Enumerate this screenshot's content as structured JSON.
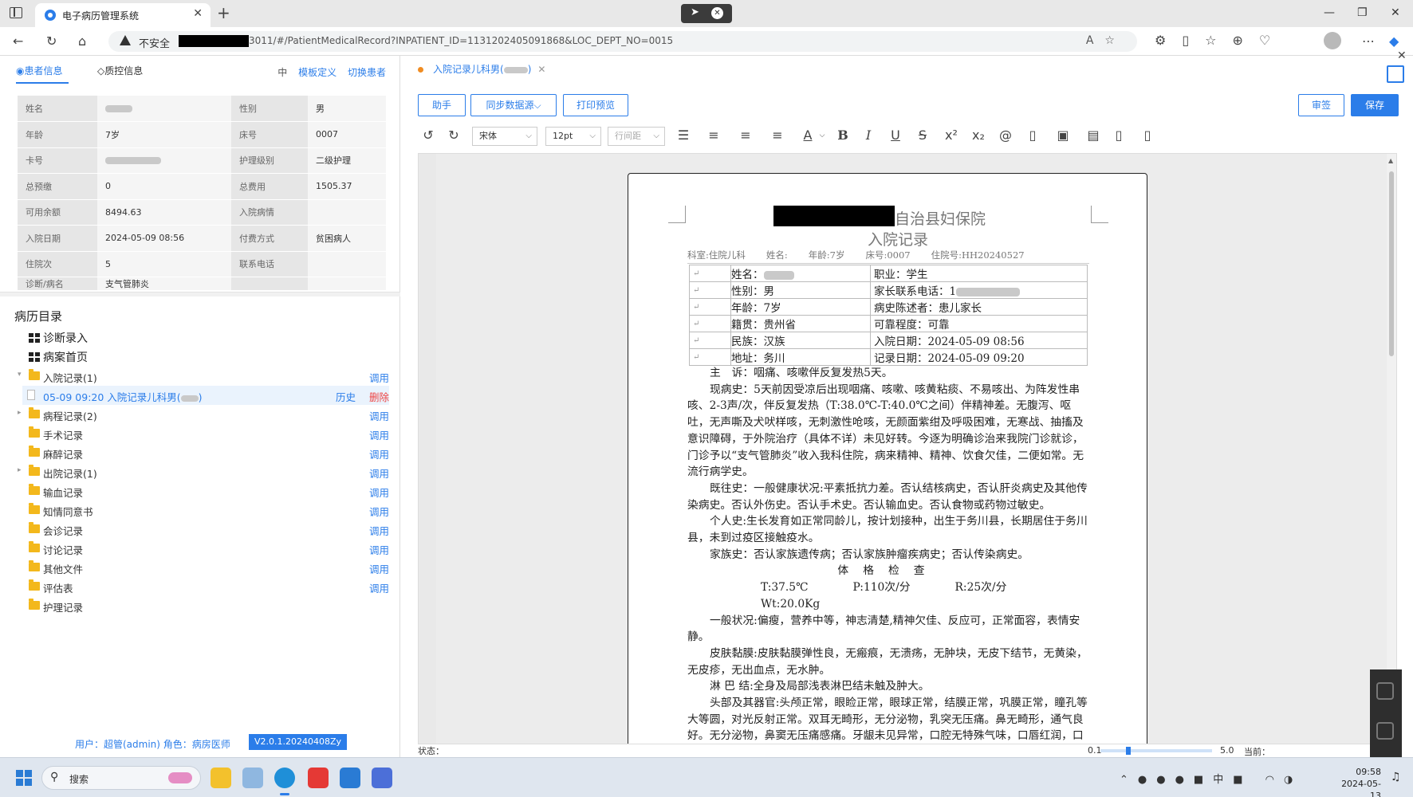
{
  "browser": {
    "tab_title": "电子病历管理系统",
    "security_label": "不安全",
    "url": "3011/#/PatientMedicalRecord?INPATIENT_ID=1131202405091868&LOC_DEPT_NO=0015"
  },
  "left": {
    "tabs": [
      "患者信息",
      "质控信息"
    ],
    "links": [
      "中",
      "模板定义",
      "切换患者"
    ],
    "info_rows": [
      {
        "k1": "姓名",
        "v1": "",
        "k2": "性别",
        "v2": "男"
      },
      {
        "k1": "年龄",
        "v1": "7岁",
        "k2": "床号",
        "v2": "0007"
      },
      {
        "k1": "卡号",
        "v1": "",
        "k2": "护理级别",
        "v2": "二级护理"
      },
      {
        "k1": "总预缴",
        "v1": "0",
        "k2": "总费用",
        "v2": "1505.37"
      },
      {
        "k1": "可用余额",
        "v1": "8494.63",
        "k2": "入院病情",
        "v2": ""
      },
      {
        "k1": "入院日期",
        "v1": "2024-05-09 08:56",
        "k2": "付费方式",
        "v2": "贫困病人"
      },
      {
        "k1": "住院次",
        "v1": "5",
        "k2": "联系电话",
        "v2": ""
      },
      {
        "k1": "诊断/病名",
        "v1": "支气管肺炎",
        "k2": "",
        "v2": ""
      }
    ],
    "tree_title": "病历目录",
    "tree": {
      "diag_entry": "诊断录入",
      "case_home": "病案首页",
      "admission": "入院记录(1)",
      "selected_record": "05-09 09:20 入院记录儿科男(",
      "history": "历史",
      "delete": "删除",
      "folders": [
        {
          "label": "病程记录(2)",
          "action": "调用"
        },
        {
          "label": "手术记录",
          "action": "调用"
        },
        {
          "label": "麻醉记录",
          "action": "调用"
        },
        {
          "label": "出院记录(1)",
          "action": "调用"
        },
        {
          "label": "输血记录",
          "action": "调用"
        },
        {
          "label": "知情同意书",
          "action": "调用"
        },
        {
          "label": "会诊记录",
          "action": "调用"
        },
        {
          "label": "讨论记录",
          "action": "调用"
        },
        {
          "label": "其他文件",
          "action": "调用"
        },
        {
          "label": "评估表",
          "action": "调用"
        },
        {
          "label": "护理记录",
          "action": ""
        }
      ],
      "call_action": "调用"
    },
    "footer_user": "用户：超管(admin) 角色：病房医师",
    "version": "V2.0.1.20240408Zy"
  },
  "editor": {
    "doc_tab": "入院记录儿科男(",
    "buttons": {
      "assistant": "助手",
      "sync": "同步数据源",
      "print": "打印预览",
      "sign": "审签",
      "save": "保存"
    },
    "font": "宋体",
    "size": "12pt",
    "line_spacing": "行间距",
    "status": "状态：",
    "zoom_min": "0.1",
    "zoom_max": "5.0",
    "current": "当前："
  },
  "page": {
    "hospital_suffix": "自治县妇保院",
    "title": "入院记录",
    "meta": [
      "科室:住院儿科",
      "姓名:",
      "年龄:7岁",
      "床号:0007",
      "住院号:HH20240527"
    ],
    "rows": [
      [
        "姓名：",
        "职业：学生"
      ],
      [
        "性别：男",
        "家长联系电话：1"
      ],
      [
        "年龄：7岁",
        "病史陈述者：患儿家长"
      ],
      [
        "籍贯：贵州省",
        "可靠程度：可靠"
      ],
      [
        "民族：汉族",
        "入院日期：2024-05-09 08:56"
      ],
      [
        "地址：务川",
        "记录日期：2024-05-09 09:20"
      ]
    ],
    "paragraphs": [
      "主　诉：咽痛、咳嗽伴反复发热5天。",
      "现病史：5天前因受凉后出现咽痛、咳嗽、咳黄粘痰、不易咳出、为阵发性串咳、2-3声/次，伴反复发热（T:38.0℃-T:40.0℃之间）伴精神差。无腹泻、呕吐，无声嘶及犬吠样咳，无刺激性呛咳，无颜面紫绀及呼吸困难，无寒战、抽搐及意识障碍，于外院治疗（具体不详）未见好转。今逐为明确诊治来我院门诊就诊，门诊予以“支气管肺炎”收入我科住院，病来精神、精神、饮食欠佳，二便如常。无流行病学史。",
      "既往史：一般健康状况:平素抵抗力差。否认结核病史，否认肝炎病史及其他传染病史。否认外伤史。否认手术史。否认输血史。否认食物或药物过敏史。",
      "个人史:生长发育如正常同龄儿，按计划接种，出生于务川县，长期居住于务川县，未到过疫区接触疫水。",
      "家族史：否认家族遗传病；否认家族肿瘤疾病史；否认传染病史。"
    ],
    "exam_title": "体格检查",
    "vitals": [
      "T:37.5℃",
      "P:110次/分",
      "R:25次/分",
      "Wt:20.0Kg"
    ],
    "paragraphs2": [
      "一般状况:偏瘦，营养中等，神志清楚,精神欠佳、反应可，正常面容，表情安静。",
      "皮肤黏膜:皮肤黏膜弹性良，无瘢痕，无溃疡，无肿块，无皮下结节，无黄染，无皮疹，无出血点，无水肿。",
      "淋 巴 结:全身及局部浅表淋巴结未触及肿大。",
      "头部及其器官:头颅正常，眼睑正常，眼球正常，结膜正常，巩膜正常，瞳孔等大等圆，对光反射正常。双耳无畸形，无分泌物，乳突无压痛。鼻无畸形，通气良好。无分泌物，鼻窦无压痛感痛。牙龈未见异常，口腔无特殊气味，口唇红润，口腔黏膜无溃"
    ]
  },
  "taskbar": {
    "search": "搜索",
    "time": "09:58",
    "date": "2024-05-13"
  }
}
